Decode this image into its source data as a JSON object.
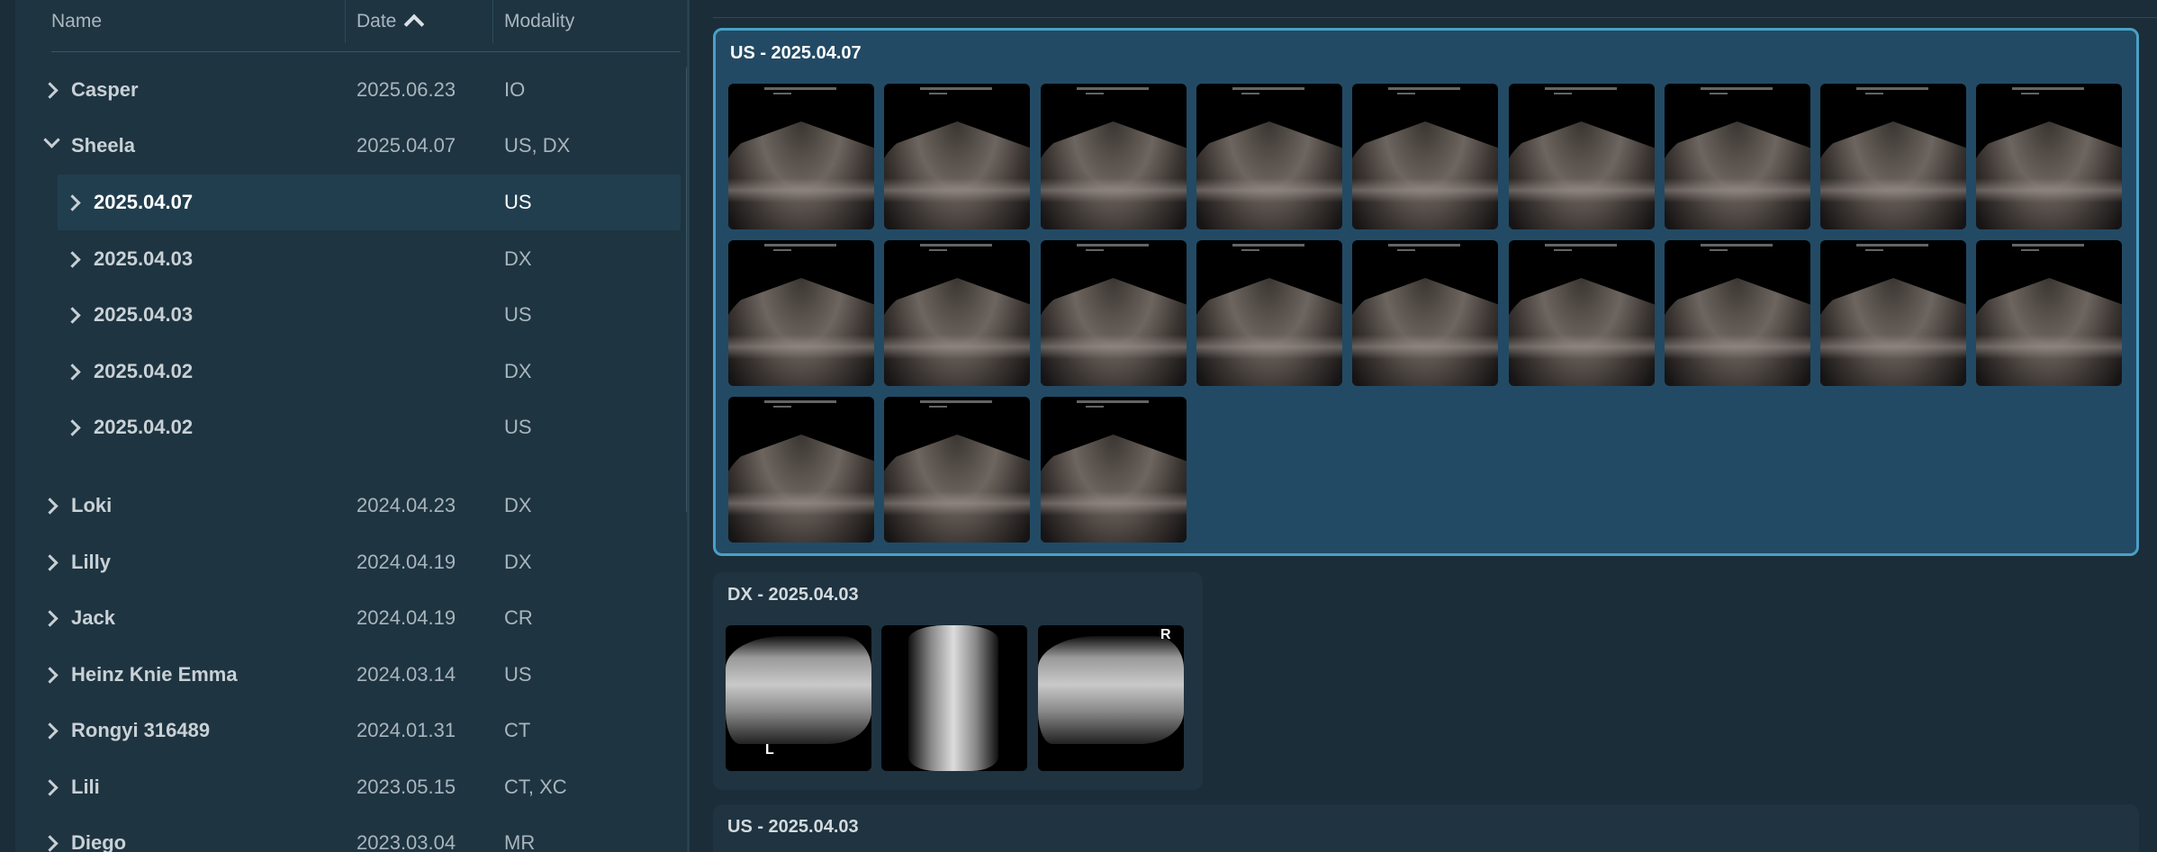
{
  "columns": {
    "name": "Name",
    "date": "Date",
    "modality": "Modality"
  },
  "patients": [
    {
      "name": "Casper",
      "date": "2025.06.23",
      "modality": "IO"
    },
    {
      "name": "Sheela",
      "date": "2025.04.07",
      "modality": "US, DX"
    },
    {
      "name": "Loki",
      "date": "2024.04.23",
      "modality": "DX"
    },
    {
      "name": "Lilly",
      "date": "2024.04.19",
      "modality": "DX"
    },
    {
      "name": "Jack",
      "date": "2024.04.19",
      "modality": "CR"
    },
    {
      "name": "Heinz Knie Emma",
      "date": "2024.03.14",
      "modality": "US"
    },
    {
      "name": "Rongyi 316489",
      "date": "2024.01.31",
      "modality": "CT"
    },
    {
      "name": "Lili",
      "date": "2023.05.15",
      "modality": "CT, XC"
    },
    {
      "name": "Diego",
      "date": "2023.03.04",
      "modality": "MR"
    }
  ],
  "sheela_studies": [
    {
      "date": "2025.04.07",
      "modality": "US"
    },
    {
      "date": "2025.04.03",
      "modality": "DX"
    },
    {
      "date": "2025.04.03",
      "modality": "US"
    },
    {
      "date": "2025.04.02",
      "modality": "DX"
    },
    {
      "date": "2025.04.02",
      "modality": "US"
    }
  ],
  "viewer": {
    "study1_title": "US - 2025.04.07",
    "study1_count": 21,
    "study2_title": "DX - 2025.04.03",
    "study2_labels": [
      "L",
      "",
      "R"
    ],
    "study3_title": "US - 2025.04.03"
  },
  "colors": {
    "accent": "#4aa0c6",
    "panel_bg": "#1e3441",
    "selected_row": "#213e4f"
  }
}
